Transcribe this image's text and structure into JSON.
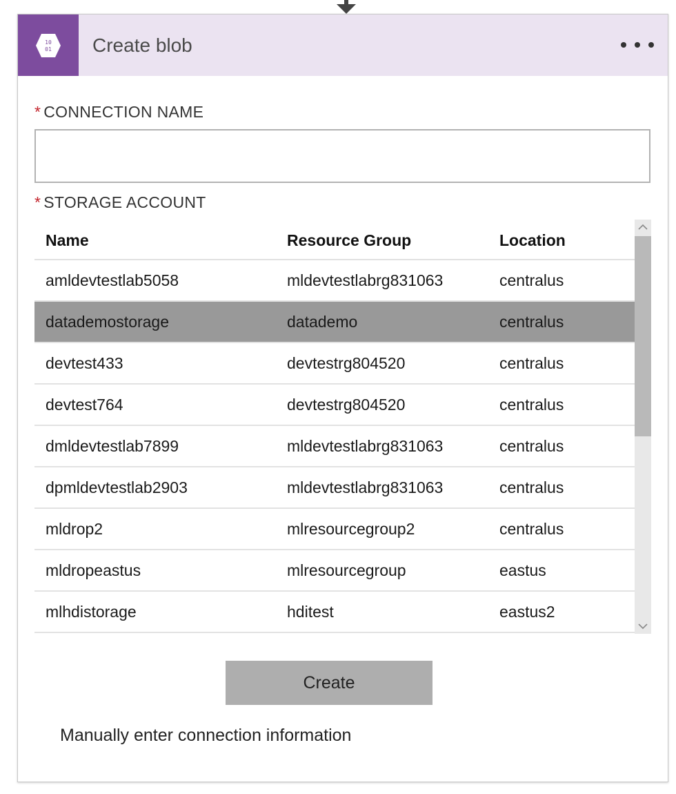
{
  "header": {
    "title": "Create blob",
    "icon": "blob-storage-icon",
    "icon_glyph": "10\n01",
    "accent_color": "#7d4c9e",
    "header_bg": "#ebe3f1"
  },
  "form": {
    "required_marker": "*",
    "connection_name_label": "CONNECTION NAME",
    "connection_name_value": "",
    "storage_account_label": "STORAGE ACCOUNT"
  },
  "table": {
    "columns": [
      "Name",
      "Resource Group",
      "Location"
    ],
    "rows": [
      {
        "name": "amldevtestlab5058",
        "group": "mldevtestlabrg831063",
        "location": "centralus",
        "selected": false
      },
      {
        "name": "datademostorage",
        "group": "datademo",
        "location": "centralus",
        "selected": true
      },
      {
        "name": "devtest433",
        "group": "devtestrg804520",
        "location": "centralus",
        "selected": false
      },
      {
        "name": "devtest764",
        "group": "devtestrg804520",
        "location": "centralus",
        "selected": false
      },
      {
        "name": "dmldevtestlab7899",
        "group": "mldevtestlabrg831063",
        "location": "centralus",
        "selected": false
      },
      {
        "name": "dpmldevtestlab2903",
        "group": "mldevtestlabrg831063",
        "location": "centralus",
        "selected": false
      },
      {
        "name": "mldrop2",
        "group": "mlresourcegroup2",
        "location": "centralus",
        "selected": false
      },
      {
        "name": "mldropeastus",
        "group": "mlresourcegroup",
        "location": "eastus",
        "selected": false
      },
      {
        "name": "mlhdistorage",
        "group": "hditest",
        "location": "eastus2",
        "selected": false
      }
    ]
  },
  "actions": {
    "create_label": "Create",
    "manual_link_label": "Manually enter connection information"
  }
}
